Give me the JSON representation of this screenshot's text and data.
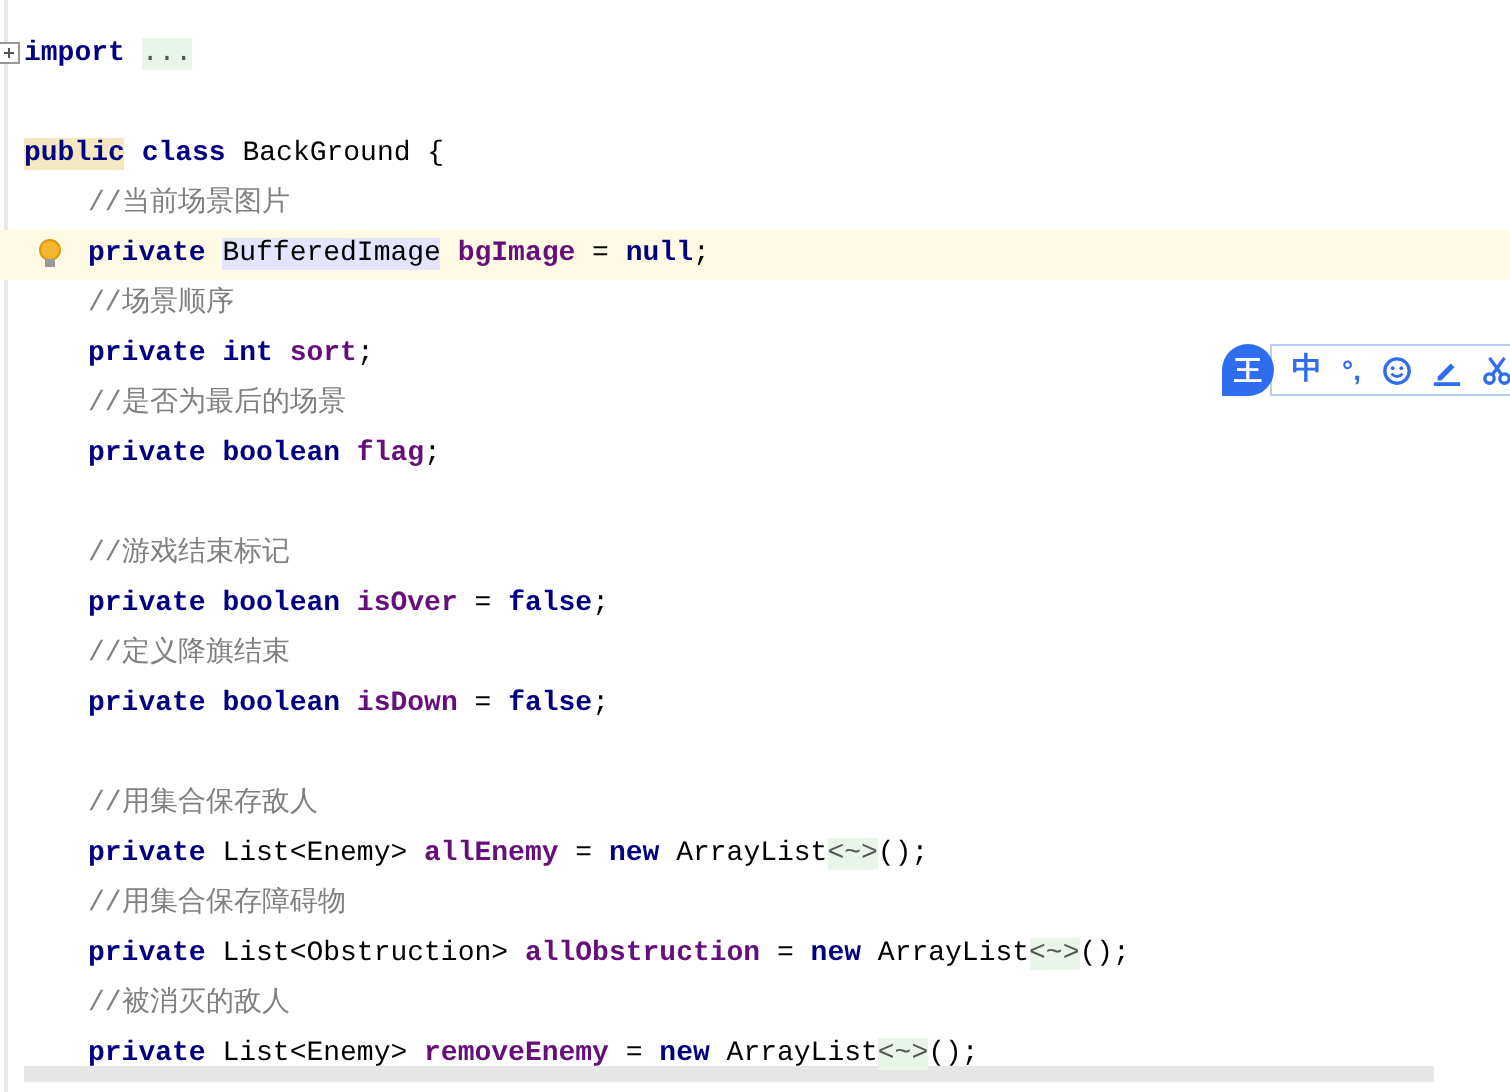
{
  "lines": [
    {
      "kind": "folded",
      "indented": false,
      "current": false,
      "tokens": [
        {
          "kind": "keyword",
          "text": "import ",
          "highlighted": false
        },
        {
          "kind": "folded",
          "text": "...",
          "highlighted": false
        }
      ]
    },
    {
      "kind": "blank",
      "current": false
    },
    {
      "kind": "code",
      "indented": false,
      "current": false,
      "tokens": [
        {
          "kind": "keyword",
          "text": "public",
          "highlighted": true
        },
        {
          "kind": "keyword",
          "text": " class",
          "highlighted": false
        },
        {
          "kind": "plain",
          "text": " BackGround {",
          "highlighted": false
        }
      ]
    },
    {
      "kind": "code",
      "indented": true,
      "current": false,
      "tokens": [
        {
          "kind": "comment",
          "text": "//当前场景图片",
          "highlighted": false
        }
      ]
    },
    {
      "kind": "intention",
      "indented": true,
      "current": true,
      "tokens": [
        {
          "kind": "keyword",
          "text": "private ",
          "highlighted": false
        },
        {
          "kind": "plain",
          "text": "BufferedImage",
          "highlighted": true
        },
        {
          "kind": "field",
          "text": " bgImage",
          "highlighted": false
        },
        {
          "kind": "plain",
          "text": " = ",
          "highlighted": false
        },
        {
          "kind": "keyword",
          "text": "null",
          "highlighted": false
        },
        {
          "kind": "plain",
          "text": ";",
          "highlighted": false
        }
      ]
    },
    {
      "kind": "code",
      "indented": true,
      "current": false,
      "tokens": [
        {
          "kind": "comment",
          "text": "//场景顺序",
          "highlighted": false
        }
      ]
    },
    {
      "kind": "code",
      "indented": true,
      "current": false,
      "tokens": [
        {
          "kind": "keyword",
          "text": "private int",
          "highlighted": false
        },
        {
          "kind": "field",
          "text": " sort",
          "highlighted": false
        },
        {
          "kind": "plain",
          "text": ";",
          "highlighted": false
        }
      ]
    },
    {
      "kind": "code",
      "indented": true,
      "current": false,
      "tokens": [
        {
          "kind": "comment",
          "text": "//是否为最后的场景",
          "highlighted": false
        }
      ]
    },
    {
      "kind": "code",
      "indented": true,
      "current": false,
      "tokens": [
        {
          "kind": "keyword",
          "text": "private boolean",
          "highlighted": false
        },
        {
          "kind": "field",
          "text": " flag",
          "highlighted": false
        },
        {
          "kind": "plain",
          "text": ";",
          "highlighted": false
        }
      ]
    },
    {
      "kind": "blank",
      "current": false
    },
    {
      "kind": "code",
      "indented": true,
      "current": false,
      "tokens": [
        {
          "kind": "comment",
          "text": "//游戏结束标记",
          "highlighted": false
        }
      ]
    },
    {
      "kind": "code",
      "indented": true,
      "current": false,
      "tokens": [
        {
          "kind": "keyword",
          "text": "private boolean",
          "highlighted": false
        },
        {
          "kind": "field",
          "text": " isOver",
          "highlighted": false
        },
        {
          "kind": "plain",
          "text": " = ",
          "highlighted": false
        },
        {
          "kind": "keyword",
          "text": "false",
          "highlighted": false
        },
        {
          "kind": "plain",
          "text": ";",
          "highlighted": false
        }
      ]
    },
    {
      "kind": "code",
      "indented": true,
      "current": false,
      "tokens": [
        {
          "kind": "comment",
          "text": "//定义降旗结束",
          "highlighted": false
        }
      ]
    },
    {
      "kind": "code",
      "indented": true,
      "current": false,
      "tokens": [
        {
          "kind": "keyword",
          "text": "private boolean",
          "highlighted": false
        },
        {
          "kind": "field",
          "text": " isDown",
          "highlighted": false
        },
        {
          "kind": "plain",
          "text": " = ",
          "highlighted": false
        },
        {
          "kind": "keyword",
          "text": "false",
          "highlighted": false
        },
        {
          "kind": "plain",
          "text": ";",
          "highlighted": false
        }
      ]
    },
    {
      "kind": "blank",
      "current": false
    },
    {
      "kind": "code",
      "indented": true,
      "current": false,
      "tokens": [
        {
          "kind": "comment",
          "text": "//用集合保存敌人",
          "highlighted": false
        }
      ]
    },
    {
      "kind": "code",
      "indented": true,
      "current": false,
      "tokens": [
        {
          "kind": "keyword",
          "text": "private",
          "highlighted": false
        },
        {
          "kind": "plain",
          "text": " List<Enemy> ",
          "highlighted": false
        },
        {
          "kind": "field",
          "text": "allEnemy",
          "highlighted": false
        },
        {
          "kind": "plain",
          "text": " = ",
          "highlighted": false
        },
        {
          "kind": "keyword",
          "text": "new",
          "highlighted": false
        },
        {
          "kind": "plain",
          "text": " ArrayList",
          "highlighted": false
        },
        {
          "kind": "folded",
          "text": "<~>",
          "highlighted": false
        },
        {
          "kind": "plain",
          "text": "();",
          "highlighted": false
        }
      ]
    },
    {
      "kind": "code",
      "indented": true,
      "current": false,
      "tokens": [
        {
          "kind": "comment",
          "text": "//用集合保存障碍物",
          "highlighted": false
        }
      ]
    },
    {
      "kind": "code",
      "indented": true,
      "current": false,
      "tokens": [
        {
          "kind": "keyword",
          "text": "private",
          "highlighted": false
        },
        {
          "kind": "plain",
          "text": " List<Obstruction> ",
          "highlighted": false
        },
        {
          "kind": "field",
          "text": "allObstruction",
          "highlighted": false
        },
        {
          "kind": "plain",
          "text": " = ",
          "highlighted": false
        },
        {
          "kind": "keyword",
          "text": "new",
          "highlighted": false
        },
        {
          "kind": "plain",
          "text": " ArrayList",
          "highlighted": false
        },
        {
          "kind": "folded",
          "text": "<~>",
          "highlighted": false
        },
        {
          "kind": "plain",
          "text": "();",
          "highlighted": false
        }
      ]
    },
    {
      "kind": "code",
      "indented": true,
      "current": false,
      "tokens": [
        {
          "kind": "comment",
          "text": "//被消灭的敌人",
          "highlighted": false
        }
      ]
    },
    {
      "kind": "code",
      "indented": true,
      "current": false,
      "tokens": [
        {
          "kind": "keyword",
          "text": "private",
          "highlighted": false
        },
        {
          "kind": "plain",
          "text": " List<Enemy> ",
          "highlighted": false
        },
        {
          "kind": "field",
          "text": "removeEnemy",
          "highlighted": false
        },
        {
          "kind": "plain",
          "text": " = ",
          "highlighted": false
        },
        {
          "kind": "keyword",
          "text": "new",
          "highlighted": false
        },
        {
          "kind": "plain",
          "text": " ArrayList",
          "highlighted": false
        },
        {
          "kind": "folded",
          "text": "<~>",
          "highlighted": false
        },
        {
          "kind": "plain",
          "text": "();",
          "highlighted": false
        }
      ]
    }
  ],
  "ime_toolbar": {
    "logo": "王",
    "mode": "中",
    "punctuation": "°,"
  }
}
